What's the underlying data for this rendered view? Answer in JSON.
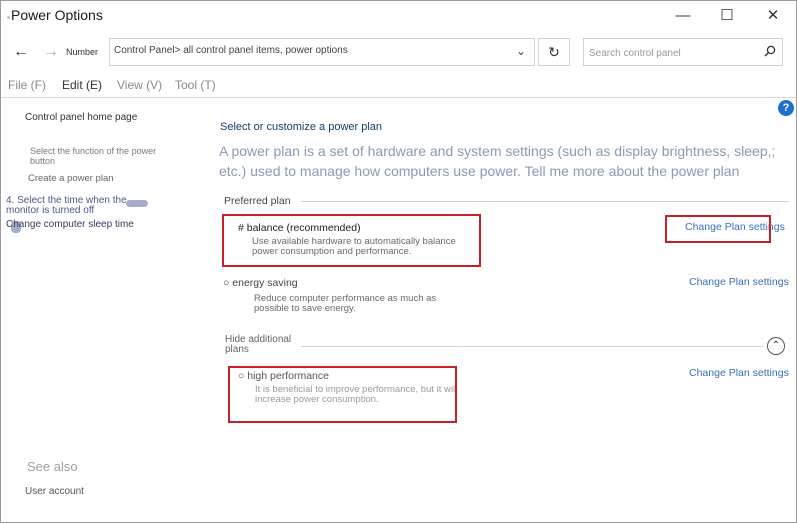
{
  "window": {
    "title": "Power Options",
    "minimize": "—",
    "maximize": "☐",
    "close": "✕"
  },
  "nav": {
    "back": "←",
    "forward": "→",
    "number_label": "Number",
    "address": "Control Panel> all control panel items, power options",
    "address_chevron": "⌄",
    "refresh": "↻",
    "search_placeholder": "Search control panel",
    "search_icon": "search-icon"
  },
  "menu": {
    "file": "File (F)",
    "edit": "Edit (E)",
    "view": "View (V)",
    "tool": "Tool (T)"
  },
  "left": {
    "home": "Control panel home page",
    "power_button": "Select the function of the power button",
    "create_plan": "Create a power plan",
    "display_off": "4. Select the time when the monitor is turned off",
    "sleep_time": "Change computer sleep time",
    "see_also": "See also",
    "user_account": "User account"
  },
  "help": "?",
  "main": {
    "heading": "Select or customize a power plan",
    "intro": "A power plan is a set of hardware and system settings (such as display brightness, sleep,; etc.) used to manage how computers use power. Tell me more about the power plan",
    "preferred_label": "Preferred plan",
    "plans": [
      {
        "name": "# balance (recommended)",
        "desc": "Use available hardware to automatically balance power consumption and performance.",
        "change": "Change Plan settings"
      },
      {
        "name": "○ energy saving",
        "desc": "Reduce computer performance as much as possible to save energy.",
        "change": "Change Plan settings"
      }
    ],
    "hide_additional": "Hide additional plans",
    "collapse_icon": "⌃",
    "additional": [
      {
        "name": "○ high performance",
        "desc": "It is beneficial to improve performance, but it will increase power consumption.",
        "change": "Change Plan settings"
      }
    ]
  },
  "colors": {
    "highlight_box": "#c8202a",
    "link": "#3b6fb6",
    "heading": "#1b3a6b",
    "help_badge": "#1f6fcf"
  }
}
